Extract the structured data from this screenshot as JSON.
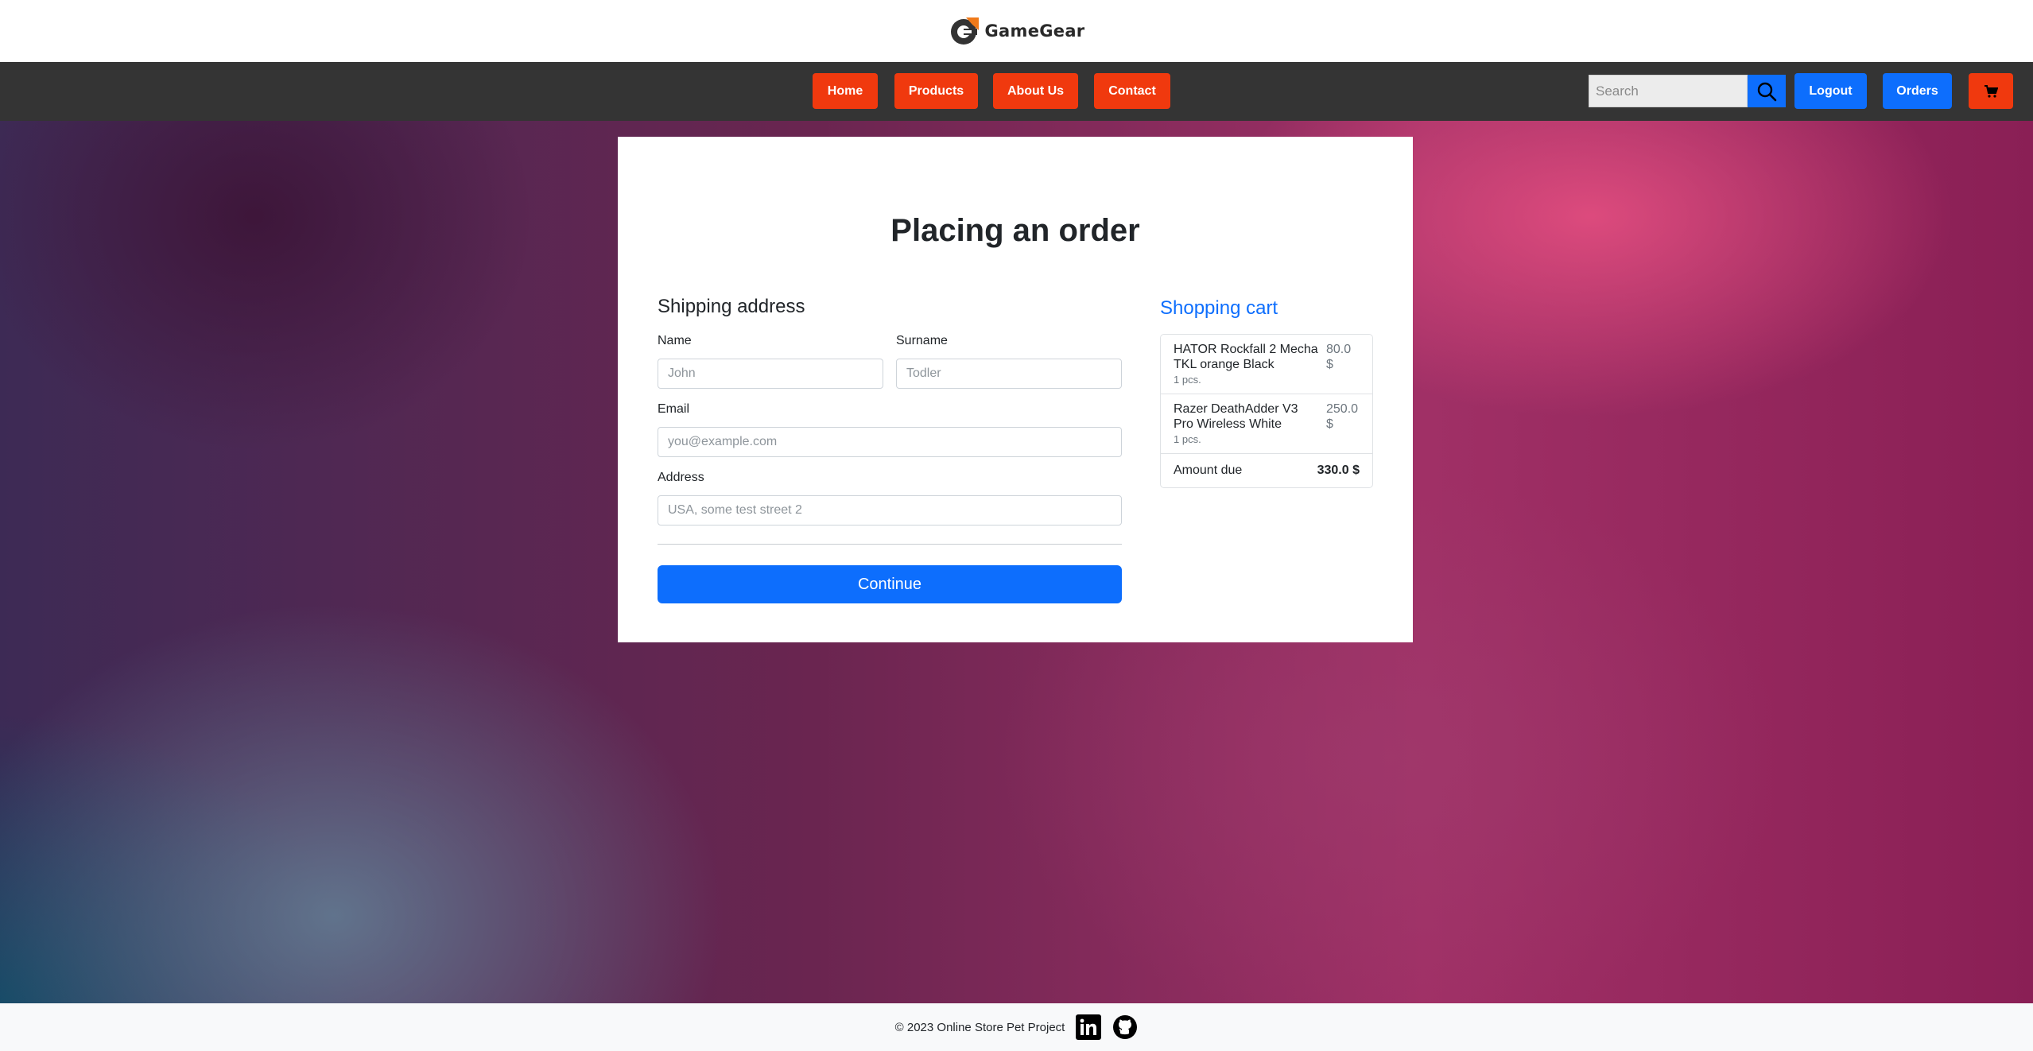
{
  "brand": {
    "name": "GameGear"
  },
  "nav": {
    "home": "Home",
    "products": "Products",
    "about": "About Us",
    "contact": "Contact",
    "search_placeholder": "Search",
    "logout": "Logout",
    "orders": "Orders"
  },
  "icons": {
    "search": "search-icon",
    "cart": "cart-icon",
    "linkedin": "linkedin-icon",
    "github": "github-icon"
  },
  "page": {
    "title": "Placing an order"
  },
  "shipping": {
    "title": "Shipping address",
    "name_label": "Name",
    "name_placeholder": "John",
    "surname_label": "Surname",
    "surname_placeholder": "Todler",
    "email_label": "Email",
    "email_placeholder": "you@example.com",
    "address_label": "Address",
    "address_placeholder": "USA, some test street 2",
    "continue": "Continue"
  },
  "cart": {
    "title": "Shopping cart",
    "items": [
      {
        "name": "HATOR Rockfall 2 Mecha TKL orange Black",
        "qty": "1 pcs.",
        "price": "80.0 $"
      },
      {
        "name": "Razer DeathAdder V3 Pro Wireless White",
        "qty": "1 pcs.",
        "price": "250.0 $"
      }
    ],
    "total_label": "Amount due",
    "total_value": "330.0 $"
  },
  "footer": {
    "copyright": "© 2023 Online Store Pet Project"
  },
  "colors": {
    "nav_bg": "#343434",
    "orange": "#f0390e",
    "blue": "#0d6efd"
  }
}
